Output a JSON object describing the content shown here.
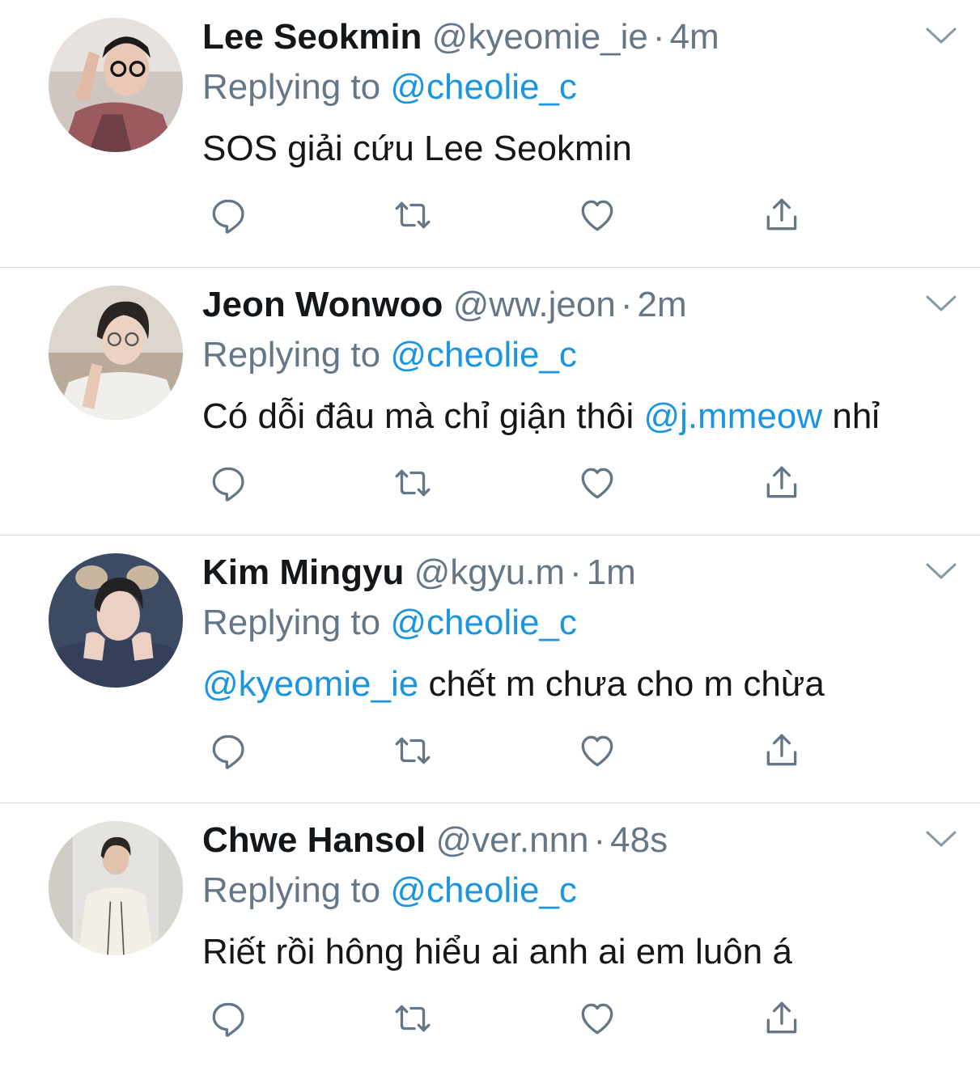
{
  "colors": {
    "link": "#1b95e0",
    "muted": "#657786",
    "text": "#14171a",
    "divider": "#d9dde1"
  },
  "tweets": [
    {
      "name": "Lee Seokmin",
      "handle": "@kyeomie_ie",
      "dot": "·",
      "time": "4m",
      "replying_prefix": "Replying to ",
      "replying_to": "@cheolie_c",
      "body": {
        "pre": "",
        "mention": "",
        "post": "SOS giải cứu Lee Seokmin"
      },
      "icons": {
        "avatar": "avatar-photo",
        "menu": "chevron-down-icon",
        "reply": "reply-icon",
        "retweet": "retweet-icon",
        "like": "heart-icon",
        "share": "share-icon"
      }
    },
    {
      "name": "Jeon Wonwoo",
      "handle": "@ww.jeon",
      "dot": "·",
      "time": "2m",
      "replying_prefix": "Replying to ",
      "replying_to": "@cheolie_c",
      "body": {
        "pre": "Có dỗi đâu mà chỉ giận thôi ",
        "mention": "@j.mmeow",
        "post": " nhỉ"
      },
      "icons": {
        "avatar": "avatar-photo",
        "menu": "chevron-down-icon",
        "reply": "reply-icon",
        "retweet": "retweet-icon",
        "like": "heart-icon",
        "share": "share-icon"
      }
    },
    {
      "name": "Kim Mingyu",
      "handle": "@kgyu.m",
      "dot": "·",
      "time": "1m",
      "replying_prefix": "Replying to ",
      "replying_to": "@cheolie_c",
      "body": {
        "pre": "",
        "mention": "@kyeomie_ie",
        "post": " chết m chưa cho m chừa"
      },
      "icons": {
        "avatar": "avatar-photo",
        "menu": "chevron-down-icon",
        "reply": "reply-icon",
        "retweet": "retweet-icon",
        "like": "heart-icon",
        "share": "share-icon"
      }
    },
    {
      "name": "Chwe Hansol",
      "handle": "@ver.nnn",
      "dot": "·",
      "time": "48s",
      "replying_prefix": "Replying to ",
      "replying_to": "@cheolie_c",
      "body": {
        "pre": "",
        "mention": "",
        "post": "Riết rồi hông hiểu ai anh ai em luôn á"
      },
      "icons": {
        "avatar": "avatar-photo",
        "menu": "chevron-down-icon",
        "reply": "reply-icon",
        "retweet": "retweet-icon",
        "like": "heart-icon",
        "share": "share-icon"
      }
    }
  ]
}
